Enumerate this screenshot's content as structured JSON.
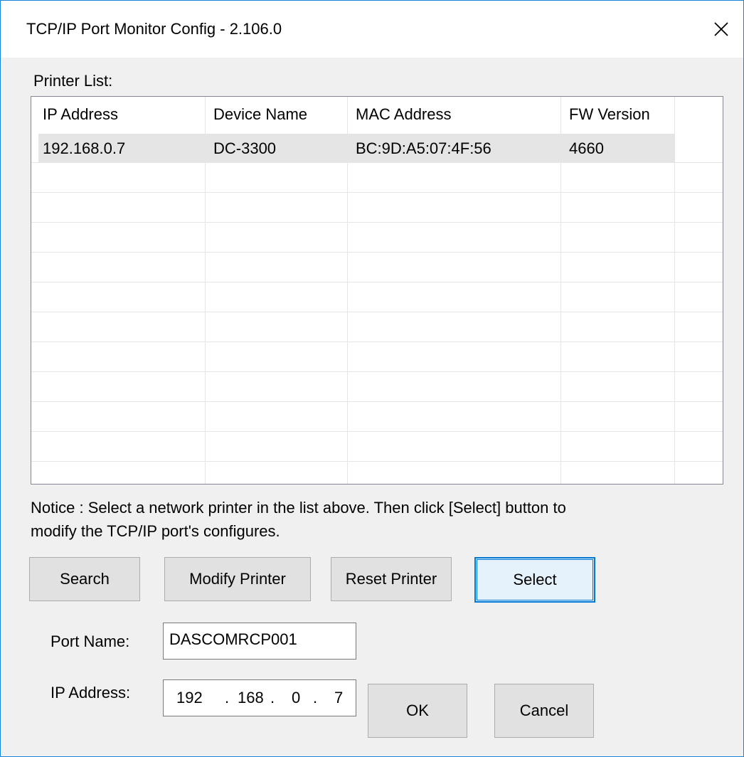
{
  "window": {
    "title": "TCP/IP Port Monitor Config - 2.106.0"
  },
  "printer_list": {
    "label": "Printer List:",
    "columns": [
      "IP Address",
      "Device Name",
      "MAC Address",
      "FW Version"
    ],
    "rows": [
      [
        "192.168.0.7",
        "DC-3300",
        "BC:9D:A5:07:4F:56",
        "4660"
      ]
    ]
  },
  "notice": {
    "line1": "Notice : Select a network printer in the list above. Then click [Select] button to",
    "line2": "modify the TCP/IP port's configures."
  },
  "buttons": {
    "search": "Search",
    "modify": "Modify Printer",
    "reset": "Reset Printer",
    "select": "Select",
    "ok": "OK",
    "cancel": "Cancel"
  },
  "port_name": {
    "label": "Port Name:",
    "value": "DASCOMRCP001"
  },
  "ip_address": {
    "label": "IP Address:",
    "octets": [
      "192",
      "168",
      "0",
      "7"
    ],
    "dot": "."
  }
}
